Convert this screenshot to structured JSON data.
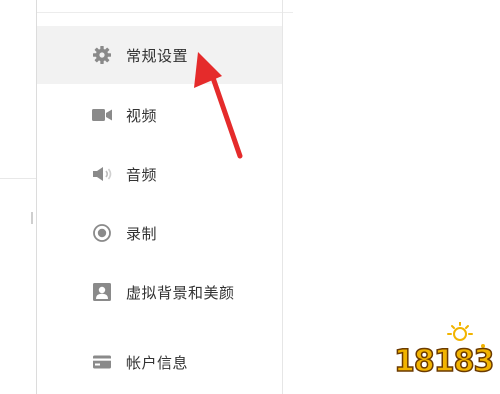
{
  "sidebar": {
    "items": [
      {
        "label": "常规设置",
        "icon": "gear-icon",
        "selected": true
      },
      {
        "label": "视频",
        "icon": "video-camera-icon",
        "selected": false
      },
      {
        "label": "音频",
        "icon": "speaker-icon",
        "selected": false
      },
      {
        "label": "录制",
        "icon": "record-icon",
        "selected": false
      },
      {
        "label": "虚拟背景和美颜",
        "icon": "portrait-icon",
        "selected": false
      },
      {
        "label": "帐户信息",
        "icon": "card-icon",
        "selected": false
      }
    ]
  },
  "annotation": {
    "arrow_color": "#e52b2b"
  },
  "watermark": {
    "text": "18183"
  },
  "colors": {
    "icon": "#8a8a8a",
    "selected_bg": "#f2f2f2",
    "text": "#333333"
  }
}
